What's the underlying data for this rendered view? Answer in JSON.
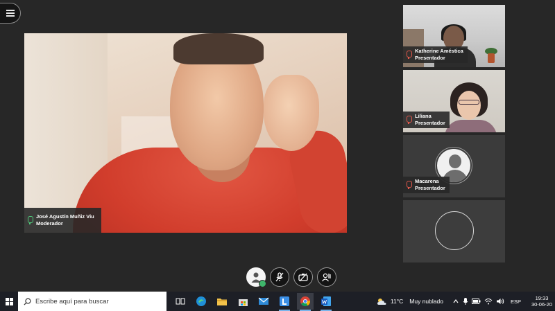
{
  "main_participant": {
    "name": "José Agustín Muñiz Viu",
    "role": "Moderador"
  },
  "participants": [
    {
      "name": "Katherine Améstica",
      "role": "Presentador",
      "mic": "muted-icon"
    },
    {
      "name": "Liliana",
      "role": "Presentador",
      "mic": "muted-icon"
    },
    {
      "name": "Macarena",
      "role": "Presentador",
      "mic": "muted-icon"
    }
  ],
  "controls": [
    "user-status-icon",
    "mic-off-icon",
    "camera-off-icon",
    "raise-hand-icon"
  ],
  "taskbar": {
    "search_placeholder": "Escribe aquí para buscar",
    "weather_temp": "11°C",
    "weather_desc": "Muy nublado",
    "language": "ESP",
    "time": "19:33",
    "date": "30-06-20"
  },
  "colors": {
    "background": "#272727",
    "mic_on": "#4fc97a",
    "mic_muted": "#e0574a",
    "taskbar": "#1d1f26"
  }
}
